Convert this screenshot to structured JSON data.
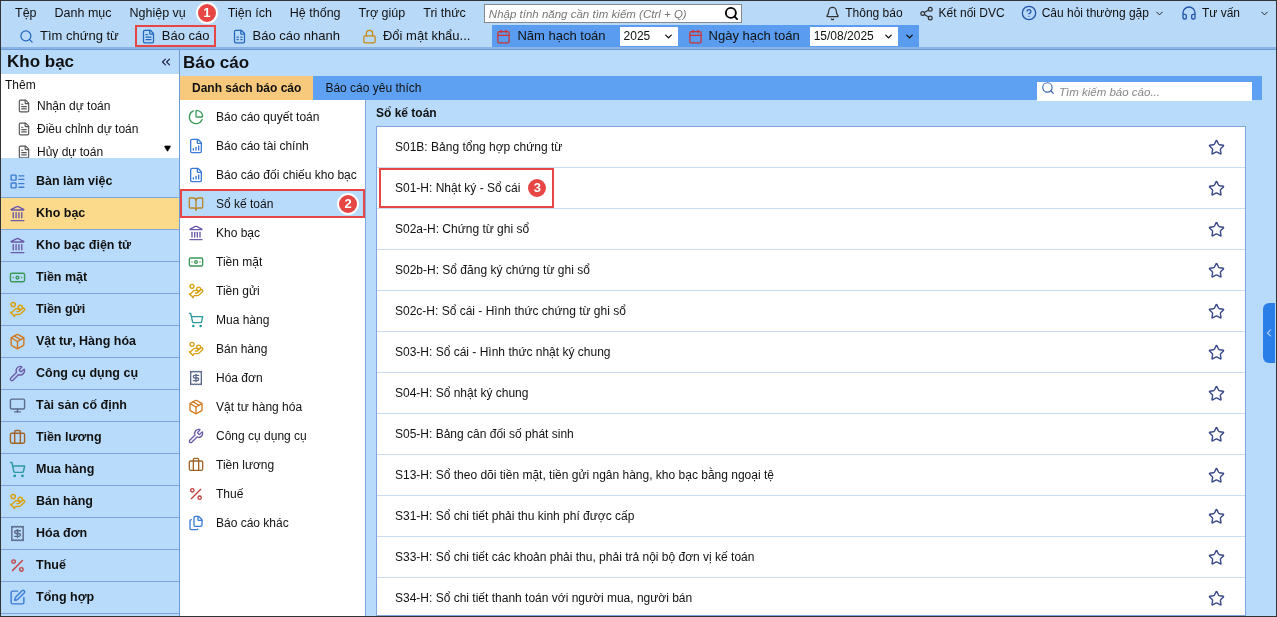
{
  "menu_bar": {
    "items": [
      "Tệp",
      "Danh mục",
      "Nghiệp vụ",
      "Tiện ích",
      "Hệ thống",
      "Trợ giúp",
      "Tri thức"
    ],
    "search": {
      "placeholder": "Nhập tính năng cần tìm kiếm (Ctrl + Q)"
    },
    "right_items": [
      {
        "kind": "bell",
        "label": "Thông báo"
      },
      {
        "kind": "connect",
        "label": "Kết nối DVC"
      },
      {
        "kind": "help",
        "label": "Câu hỏi thường gặp"
      },
      {
        "kind": "headset",
        "label": "Tư vấn"
      }
    ]
  },
  "toolbar": {
    "buttons": [
      {
        "kind": "search",
        "label": "Tìm chứng từ"
      },
      {
        "kind": "report",
        "label": "Báo cáo",
        "annotation": "1"
      },
      {
        "kind": "quick",
        "label": "Báo cáo nhanh"
      },
      {
        "kind": "lock",
        "label": "Đổi mật khẩu..."
      }
    ],
    "year_label": "Năm hạch toán",
    "year": "2025",
    "date_label": "Ngày hạch toán",
    "date": "15/08/2025"
  },
  "sidebar": {
    "title": "Kho bạc",
    "more_label": "Thêm",
    "quick_items": [
      "Nhận dự toán",
      "Điều chỉnh dự toán",
      "Hủy dự toán"
    ],
    "nav_items": [
      {
        "label": "Bàn làm việc",
        "selected": false
      },
      {
        "label": "Kho bạc",
        "selected": true
      },
      {
        "label": "Kho bạc điện tử",
        "selected": false
      },
      {
        "label": "Tiền mặt",
        "selected": false
      },
      {
        "label": "Tiền gửi",
        "selected": false
      },
      {
        "label": "Vật tư, Hàng hóa",
        "selected": false
      },
      {
        "label": "Công cụ dụng cụ",
        "selected": false
      },
      {
        "label": "Tài sản cố định",
        "selected": false
      },
      {
        "label": "Tiền lương",
        "selected": false
      },
      {
        "label": "Mua hàng",
        "selected": false
      },
      {
        "label": "Bán hàng",
        "selected": false
      },
      {
        "label": "Hóa đơn",
        "selected": false
      },
      {
        "label": "Thuế",
        "selected": false
      },
      {
        "label": "Tổng hợp",
        "selected": false
      }
    ]
  },
  "main": {
    "title": "Báo cáo",
    "tabs": [
      {
        "label": "Danh sách báo cáo",
        "selected": true
      },
      {
        "label": "Báo cáo yêu thích",
        "selected": false
      }
    ],
    "report_search": {
      "placeholder": "Tìm kiếm báo cáo..."
    },
    "categories": [
      {
        "label": "Báo cáo quyết toán",
        "selected": false
      },
      {
        "label": "Báo cáo tài chính",
        "selected": false
      },
      {
        "label": "Báo cáo đối chiếu kho bạc",
        "selected": false
      },
      {
        "label": "Sổ kế toán",
        "selected": true,
        "annotation": "2"
      },
      {
        "label": "Kho bạc",
        "selected": false
      },
      {
        "label": "Tiền mặt",
        "selected": false
      },
      {
        "label": "Tiền gửi",
        "selected": false
      },
      {
        "label": "Mua hàng",
        "selected": false
      },
      {
        "label": "Bán hàng",
        "selected": false
      },
      {
        "label": "Hóa đơn",
        "selected": false
      },
      {
        "label": "Vật tư hàng hóa",
        "selected": false
      },
      {
        "label": "Công cụ dụng cụ",
        "selected": false
      },
      {
        "label": "Tiền lương",
        "selected": false
      },
      {
        "label": "Thuế",
        "selected": false
      },
      {
        "label": "Báo cáo khác",
        "selected": false
      }
    ],
    "section_title": "Sổ kế toán",
    "reports": [
      {
        "label": "S01B: Bảng tổng hợp chứng từ",
        "favorite": false
      },
      {
        "label": "S01-H: Nhật ký - Sổ cái",
        "favorite": false,
        "annotation": "3"
      },
      {
        "label": "S02a-H: Chứng từ ghi sổ",
        "favorite": false
      },
      {
        "label": "S02b-H: Sổ đăng ký chứng từ ghi sổ",
        "favorite": false
      },
      {
        "label": "S02c-H: Sổ cái - Hình thức chứng từ ghi sổ",
        "favorite": false
      },
      {
        "label": "S03-H: Sổ cái - Hình thức nhật ký chung",
        "favorite": false
      },
      {
        "label": "S04-H: Sổ nhật ký chung",
        "favorite": false
      },
      {
        "label": "S05-H: Bảng cân đối số phát sinh",
        "favorite": false
      },
      {
        "label": "S13-H: Sổ theo dõi tiền mặt, tiền gửi ngân hàng, kho bạc bằng ngoại tệ",
        "favorite": false
      },
      {
        "label": "S31-H: Sổ chi tiết phải thu kinh phí được cấp",
        "favorite": false
      },
      {
        "label": "S33-H: Sổ chi tiết các khoản phải thu, phải trả nội bộ đơn vị kế toán",
        "favorite": false
      },
      {
        "label": "S34-H: Sổ chi tiết thanh toán với người mua, người bán",
        "favorite": false
      }
    ]
  }
}
